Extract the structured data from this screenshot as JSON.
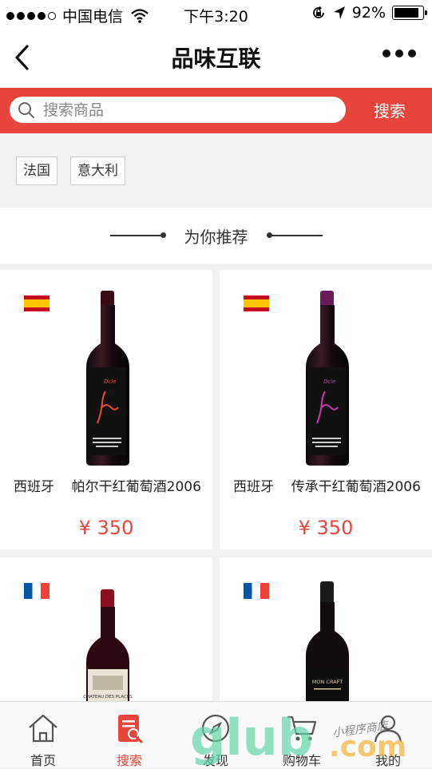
{
  "status": {
    "carrier": "中国电信",
    "time": "下午3:20",
    "battery": "92%"
  },
  "nav": {
    "title": "品味互联"
  },
  "search": {
    "placeholder": "搜索商品",
    "button": "搜索"
  },
  "tags": [
    "法国",
    "意大利"
  ],
  "section_title": "为你推荐",
  "products": [
    {
      "country": "西班牙",
      "name": "帕尔干红葡萄酒2006",
      "price": "¥ 350",
      "flag": "spain"
    },
    {
      "country": "西班牙",
      "name": "传承干红葡萄酒2006",
      "price": "¥ 350",
      "flag": "spain"
    },
    {
      "country": "",
      "name": "",
      "price": "",
      "flag": "france"
    },
    {
      "country": "",
      "name": "",
      "price": "",
      "flag": "france"
    }
  ],
  "bottle_labels": {
    "p3": "CHATEAU DES PLACES",
    "p4": "MON CRAFT"
  },
  "tabs": [
    {
      "label": "首页",
      "icon": "home-icon"
    },
    {
      "label": "搜索",
      "icon": "search-list-icon"
    },
    {
      "label": "发现",
      "icon": "compass-icon"
    },
    {
      "label": "购物车",
      "icon": "cart-icon"
    },
    {
      "label": "我的",
      "icon": "user-icon"
    }
  ],
  "watermark": {
    "logo": "glub.com",
    "handwriting": "小程序商店"
  },
  "colors": {
    "accent": "#e8453c",
    "text": "#333333",
    "background": "#f2f2f2"
  }
}
